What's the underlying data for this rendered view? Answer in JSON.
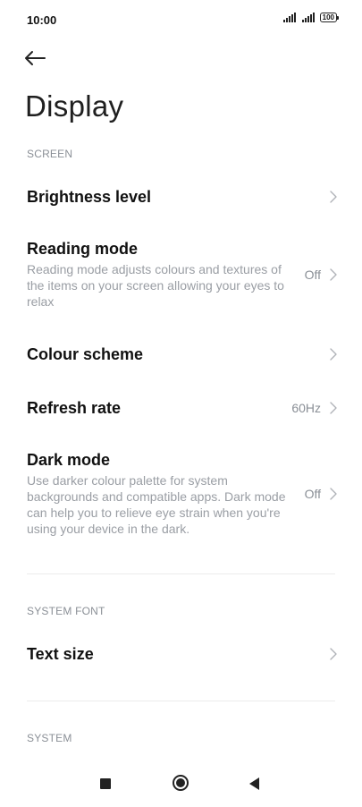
{
  "status_bar": {
    "time": "10:00",
    "battery": "100"
  },
  "page": {
    "title": "Display"
  },
  "sections": {
    "screen": "SCREEN",
    "system_font": "SYSTEM FONT",
    "system": "SYSTEM"
  },
  "items": {
    "brightness": {
      "title": "Brightness level"
    },
    "reading_mode": {
      "title": "Reading mode",
      "description": "Reading mode adjusts colours and textures of the items on your screen allowing your eyes to relax",
      "value": "Off"
    },
    "colour_scheme": {
      "title": "Colour scheme"
    },
    "refresh_rate": {
      "title": "Refresh rate",
      "value": "60Hz"
    },
    "dark_mode": {
      "title": "Dark mode",
      "description": "Use darker colour palette for system backgrounds and compatible apps. Dark mode can help you to relieve eye strain when you're using your device in the dark.",
      "value": "Off"
    },
    "text_size": {
      "title": "Text size"
    }
  },
  "icons": {
    "back": "arrow-left-icon",
    "chevron": "chevron-right-icon",
    "nav_recents": "square-icon",
    "nav_home": "circle-icon",
    "nav_back": "triangle-left-icon"
  },
  "colors": {
    "background": "#ffffff",
    "title_text": "#111111",
    "secondary_text": "#9a9ea4",
    "section_header": "#8a8f96"
  }
}
